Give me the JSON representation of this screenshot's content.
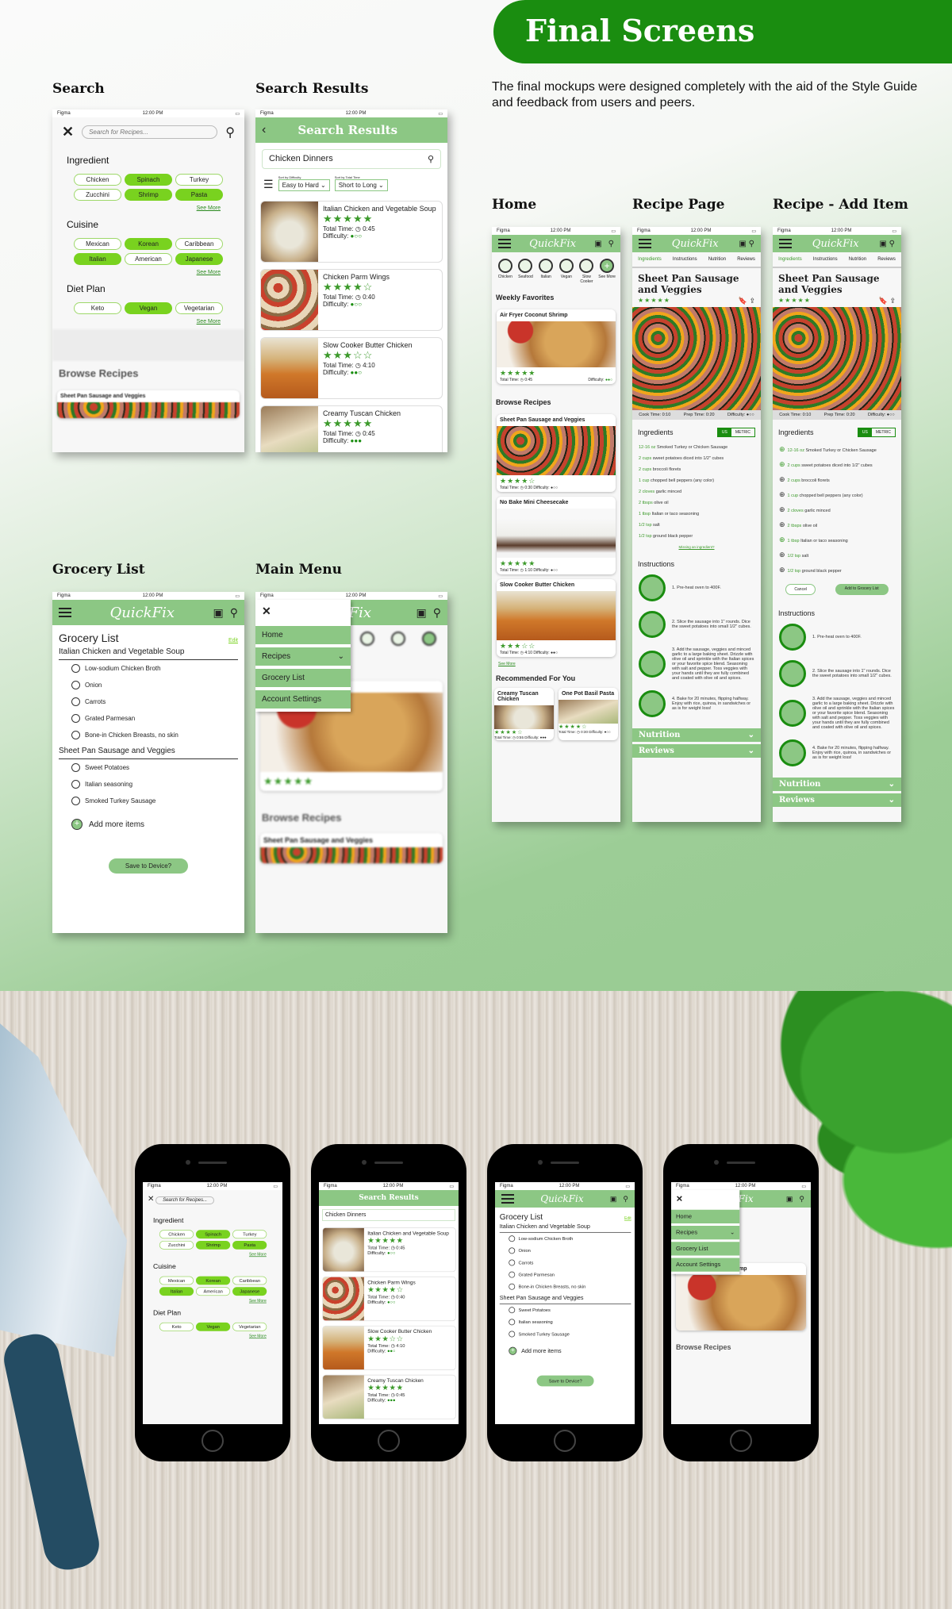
{
  "header": {
    "title": "Final Screens",
    "intro": "The final mockups were designed completely with the aid of the Style Guide and feedback from users and peers."
  },
  "labels": {
    "search": "Search",
    "search_results": "Search Results",
    "home": "Home",
    "recipe_page": "Recipe Page",
    "recipe_add": "Recipe - Add Item",
    "grocery": "Grocery List",
    "main_menu": "Main Menu"
  },
  "status": {
    "carrier": "Figma",
    "time": "12:00 PM"
  },
  "app": {
    "name": "QuickFix"
  },
  "search": {
    "placeholder": "Search for Recipes...",
    "sections": [
      {
        "title": "Ingredient",
        "chips": [
          {
            "label": "Chicken",
            "on": false
          },
          {
            "label": "Spinach",
            "on": true
          },
          {
            "label": "Turkey",
            "on": false
          },
          {
            "label": "Zucchini",
            "on": false
          },
          {
            "label": "Shrimp",
            "on": true
          },
          {
            "label": "Pasta",
            "on": true
          }
        ]
      },
      {
        "title": "Cuisine",
        "chips": [
          {
            "label": "Mexican",
            "on": false
          },
          {
            "label": "Korean",
            "on": true
          },
          {
            "label": "Caribbean",
            "on": false
          },
          {
            "label": "Italian",
            "on": true
          },
          {
            "label": "American",
            "on": false
          },
          {
            "label": "Japanese",
            "on": true
          }
        ]
      },
      {
        "title": "Diet Plan",
        "chips": [
          {
            "label": "Keto",
            "on": false
          },
          {
            "label": "Vegan",
            "on": true
          },
          {
            "label": "Vegetarian",
            "on": false
          }
        ]
      }
    ],
    "see_more": "See More",
    "browse": "Browse Recipes",
    "browse_item": "Sheet Pan Sausage and Veggies"
  },
  "results": {
    "title": "Search Results",
    "query": "Chicken Dinners",
    "sort_diff_label": "Sort by Difficulty",
    "sort_diff": "Easy to Hard",
    "sort_time_label": "Sort by Total Time",
    "sort_time": "Short to Long",
    "items": [
      {
        "name": "Italian Chicken and Vegetable Soup",
        "stars": "★★★★★",
        "time": "0:45",
        "difficulty": "●○○"
      },
      {
        "name": "Chicken Parm Wings",
        "stars": "★★★★☆",
        "time": "0:40",
        "difficulty": "●○○"
      },
      {
        "name": "Slow Cooker Butter Chicken",
        "stars": "★★★☆☆",
        "time": "4:10",
        "difficulty": "●●○"
      },
      {
        "name": "Creamy Tuscan Chicken",
        "stars": "★★★★★",
        "time": "0:45",
        "difficulty": "●●●"
      }
    ],
    "total_time_label": "Total Time:",
    "difficulty_label": "Difficulty:"
  },
  "home": {
    "categories": [
      "Chicken",
      "Seafood",
      "Italian",
      "Vegan",
      "Slow Cooker",
      "See More"
    ],
    "weekly": "Weekly Favorites",
    "featured": {
      "name": "Air Fryer Coconut Shrimp",
      "stars": "★★★★★",
      "time": "0:45",
      "difficulty": "●●○"
    },
    "browse": "Browse Recipes",
    "browse_items": [
      {
        "name": "Sheet Pan Sausage and Veggies",
        "stars": "★★★★☆",
        "time": "0:30",
        "difficulty": "●○○"
      },
      {
        "name": "No Bake Mini Cheesecake",
        "stars": "★★★★★",
        "time": "1:10",
        "difficulty": "●○○"
      },
      {
        "name": "Slow Cooker Butter Chicken",
        "stars": "★★★☆☆",
        "time": "4:10",
        "difficulty": "●●○"
      }
    ],
    "see_more": "See More",
    "recommended": "Recommended For You",
    "rec_items": [
      {
        "name": "Creamy Tuscan Chicken",
        "stars": "★★★★☆",
        "time": "0:55",
        "difficulty": "●●●"
      },
      {
        "name": "One Pot Basil Pasta",
        "stars": "★★★★☆",
        "time": "0:30",
        "difficulty": "●○○"
      }
    ]
  },
  "recipe": {
    "tabs": [
      "Ingredients",
      "Instructions",
      "Nutrition",
      "Reviews"
    ],
    "title": "Sheet Pan Sausage and Veggies",
    "stars": "★★★★★",
    "cook": "Cook Time: 0:10",
    "prep": "Prep Time: 0:20",
    "difficulty": "Difficulty: ●○○",
    "ingredients_title": "Ingredients",
    "units": [
      "US",
      "METRIC"
    ],
    "ingredients": [
      {
        "qty": "12-16 oz",
        "item": "Smoked Turkey or Chicken Sausage",
        "added": true
      },
      {
        "qty": "2 cups",
        "item": "sweet potatoes diced into 1/2\" cubes",
        "added": true
      },
      {
        "qty": "2 cups",
        "item": "broccoli florets",
        "added": false
      },
      {
        "qty": "1 cup",
        "item": "chopped bell peppers (any color)",
        "added": false
      },
      {
        "qty": "2 cloves",
        "item": "garlic minced",
        "added": false
      },
      {
        "qty": "2 tbsps",
        "item": "olive oil",
        "added": false
      },
      {
        "qty": "1 tbsp",
        "item": "Italian or taco seasoning",
        "added": true
      },
      {
        "qty": "1/2 tsp",
        "item": "salt",
        "added": false
      },
      {
        "qty": "1/2 tsp",
        "item": "ground black pepper",
        "added": false
      }
    ],
    "missing": "Missing an ingredient?",
    "cancel": "Cancel",
    "add_grocery": "Add to Grocery List",
    "instructions_title": "Instructions",
    "steps": [
      "1.  Pre-heat oven to 400F.",
      "2.  Slice the sausage into 1\" rounds. Dice the sweet potatoes into small 1/2\" cubes.",
      "3.  Add the sausage, veggies and minced garlic to a large baking sheet. Drizzle with olive oil and sprinkle with the Italian spices or your favorite spice blend. Seasoning with salt and pepper. Toss veggies with your hands until they are fully combined and coated with olive oil and spices.",
      "4.  Bake for 20 minutes, flipping halfway. Enjoy with rice, quinoa, in sandwiches or as is for weight loss!"
    ],
    "nutrition": "Nutrition",
    "reviews": "Reviews"
  },
  "grocery": {
    "title": "Grocery List",
    "edit": "Edit",
    "groups": [
      {
        "name": "Italian Chicken and Vegetable Soup",
        "items": [
          "Low-sodium Chicken Broth",
          "Onion",
          "Carrots",
          "Grated Parmesan",
          "Bone-in Chicken Breasts, no skin"
        ]
      },
      {
        "name": "Sheet Pan Sausage and Veggies",
        "items": [
          "Sweet Potatoes",
          "Italian seasoning",
          "Smoked Turkey Sausage"
        ]
      }
    ],
    "add_more": "Add more items",
    "save": "Save to Device?"
  },
  "menu": {
    "items": [
      "Home",
      "Recipes",
      "Grocery List",
      "Account Settings"
    ]
  },
  "colors": {
    "brand": "#1a8d10",
    "appbar": "#8cc784",
    "chip_active": "#79d21f"
  }
}
